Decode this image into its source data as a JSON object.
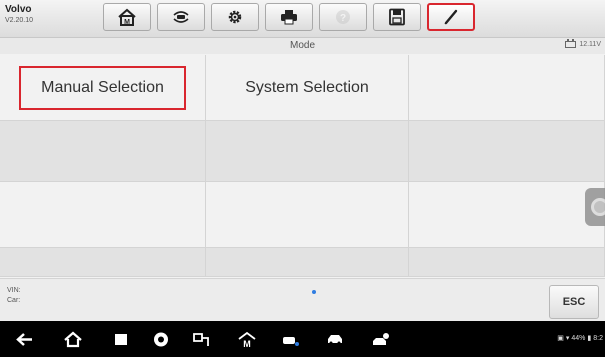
{
  "header": {
    "make": "Volvo",
    "version": "V2.20.10",
    "toolbar": [
      {
        "name": "home-button",
        "icon": "home-icon",
        "selected": false,
        "disabled": false
      },
      {
        "name": "vehicle-swap-button",
        "icon": "vehicle-swap-icon",
        "selected": false,
        "disabled": false
      },
      {
        "name": "settings-button",
        "icon": "gear-icon",
        "selected": false,
        "disabled": false
      },
      {
        "name": "print-button",
        "icon": "printer-icon",
        "selected": false,
        "disabled": false
      },
      {
        "name": "help-button",
        "icon": "help-icon",
        "selected": false,
        "disabled": true
      },
      {
        "name": "save-button",
        "icon": "save-icon",
        "selected": false,
        "disabled": false
      },
      {
        "name": "datalog-button",
        "icon": "pen-icon",
        "selected": true,
        "disabled": false
      }
    ]
  },
  "mode_bar": {
    "title": "Mode",
    "voltage": "12.11V"
  },
  "menu": {
    "items": [
      "Manual Selection",
      "System Selection",
      "",
      "",
      "",
      "",
      "",
      "",
      "",
      "",
      "",
      ""
    ],
    "highlighted": "Manual Selection"
  },
  "info": {
    "vin_label": "VIN:",
    "car_label": "Car:",
    "esc_label": "ESC"
  },
  "system_nav": {
    "icons": [
      "back-icon",
      "home-icon",
      "recent-apps-icon",
      "browser-icon",
      "connect-icon",
      "autel-home-icon",
      "vci-icon",
      "car-icon",
      "remote-icon"
    ],
    "status_text": "44%",
    "clock": "8:2"
  },
  "colors": {
    "highlight": "#d9262e",
    "accent_dot": "#2f7de1"
  }
}
